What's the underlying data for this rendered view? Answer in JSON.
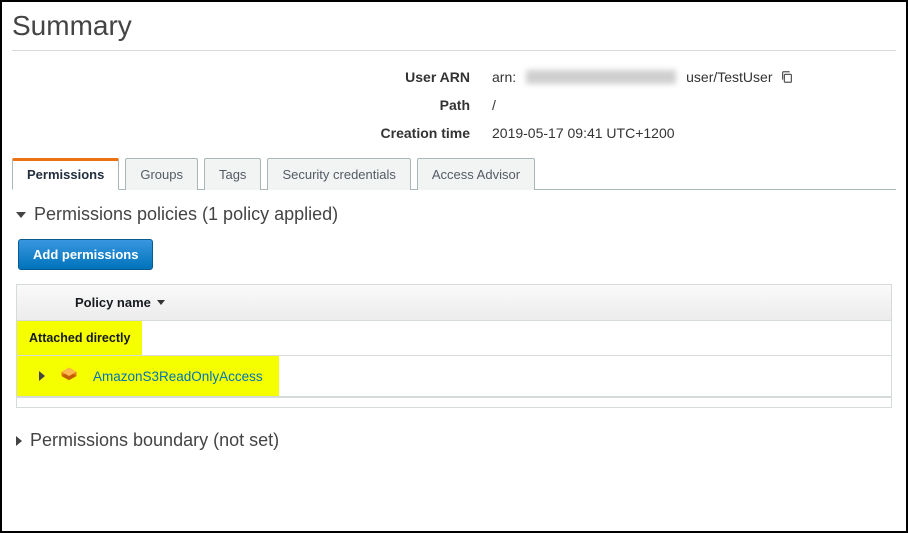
{
  "title": "Summary",
  "meta": {
    "arn_label": "User ARN",
    "arn_prefix": "arn:",
    "arn_suffix": "user/TestUser",
    "path_label": "Path",
    "path_value": "/",
    "creation_label": "Creation time",
    "creation_value": "2019-05-17 09:41 UTC+1200"
  },
  "tabs": {
    "permissions": "Permissions",
    "groups": "Groups",
    "tags": "Tags",
    "security": "Security credentials",
    "advisor": "Access Advisor"
  },
  "policies_section": {
    "heading": "Permissions policies (1 policy applied)",
    "add_btn": "Add permissions",
    "col_policy_name": "Policy name",
    "group_attached_directly": "Attached directly",
    "policy1_name": "AmazonS3ReadOnlyAccess"
  },
  "boundary_section": {
    "heading": "Permissions boundary (not set)"
  }
}
